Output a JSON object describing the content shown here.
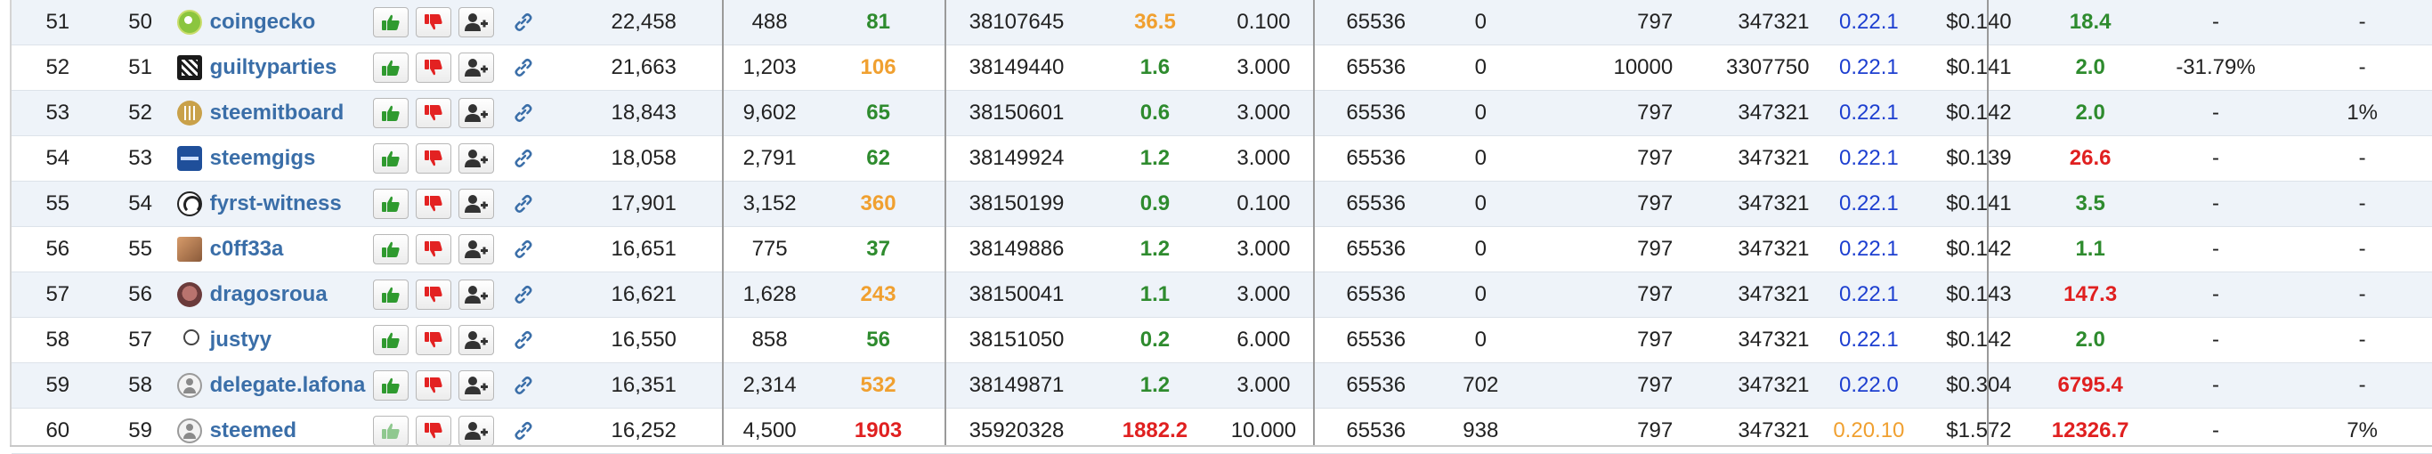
{
  "colors": {
    "green": "#2e8b2e",
    "orange": "#f0a030",
    "red": "#e02020",
    "blue": "#1d3fd0",
    "link": "#3a6ea8",
    "row_alt": "#eef3f9"
  },
  "actions": {
    "vote_icon": "thumbs-up-icon",
    "unvote_icon": "thumbs-down-icon",
    "proxy_icon": "add-user-icon",
    "link_icon": "chain-link-icon"
  },
  "rows": [
    {
      "rank": "51",
      "prev": "50",
      "name": "coingecko",
      "avatar": "coingecko",
      "votes": "22,458",
      "voters": "488",
      "missed": "81",
      "missed_color": "green",
      "last_block": "38107645",
      "hours": "36.5",
      "hours_color": "orange",
      "fee": "0.100",
      "size": "65536",
      "rate": "0",
      "sbd_interest": "797",
      "sbd_base": "347321",
      "version": "0.22.1",
      "version_color": "blue",
      "price": "$0.140",
      "feed": "18.4",
      "feed_color": "green",
      "change": "-",
      "extra": "-"
    },
    {
      "rank": "52",
      "prev": "51",
      "name": "guiltyparties",
      "avatar": "guilty",
      "votes": "21,663",
      "voters": "1,203",
      "missed": "106",
      "missed_color": "orange",
      "last_block": "38149440",
      "hours": "1.6",
      "hours_color": "green",
      "fee": "3.000",
      "size": "65536",
      "rate": "0",
      "sbd_interest": "10000",
      "sbd_base": "3307750",
      "version": "0.22.1",
      "version_color": "blue",
      "price": "$0.141",
      "feed": "2.0",
      "feed_color": "green",
      "change": "-31.79%",
      "extra": "-"
    },
    {
      "rank": "53",
      "prev": "52",
      "name": "steemitboard",
      "avatar": "board",
      "votes": "18,843",
      "voters": "9,602",
      "missed": "65",
      "missed_color": "green",
      "last_block": "38150601",
      "hours": "0.6",
      "hours_color": "green",
      "fee": "3.000",
      "size": "65536",
      "rate": "0",
      "sbd_interest": "797",
      "sbd_base": "347321",
      "version": "0.22.1",
      "version_color": "blue",
      "price": "$0.142",
      "feed": "2.0",
      "feed_color": "green",
      "change": "-",
      "extra": "1%"
    },
    {
      "rank": "54",
      "prev": "53",
      "name": "steemgigs",
      "avatar": "gigs",
      "votes": "18,058",
      "voters": "2,791",
      "missed": "62",
      "missed_color": "green",
      "last_block": "38149924",
      "hours": "1.2",
      "hours_color": "green",
      "fee": "3.000",
      "size": "65536",
      "rate": "0",
      "sbd_interest": "797",
      "sbd_base": "347321",
      "version": "0.22.1",
      "version_color": "blue",
      "price": "$0.139",
      "feed": "26.6",
      "feed_color": "red",
      "change": "-",
      "extra": "-"
    },
    {
      "rank": "55",
      "prev": "54",
      "name": "fyrst-witness",
      "avatar": "fyrst",
      "votes": "17,901",
      "voters": "3,152",
      "missed": "360",
      "missed_color": "orange",
      "last_block": "38150199",
      "hours": "0.9",
      "hours_color": "green",
      "fee": "0.100",
      "size": "65536",
      "rate": "0",
      "sbd_interest": "797",
      "sbd_base": "347321",
      "version": "0.22.1",
      "version_color": "blue",
      "price": "$0.141",
      "feed": "3.5",
      "feed_color": "green",
      "change": "-",
      "extra": "-"
    },
    {
      "rank": "56",
      "prev": "55",
      "name": "c0ff33a",
      "avatar": "coff",
      "votes": "16,651",
      "voters": "775",
      "missed": "37",
      "missed_color": "green",
      "last_block": "38149886",
      "hours": "1.2",
      "hours_color": "green",
      "fee": "3.000",
      "size": "65536",
      "rate": "0",
      "sbd_interest": "797",
      "sbd_base": "347321",
      "version": "0.22.1",
      "version_color": "blue",
      "price": "$0.142",
      "feed": "1.1",
      "feed_color": "green",
      "change": "-",
      "extra": "-"
    },
    {
      "rank": "57",
      "prev": "56",
      "name": "dragosroua",
      "avatar": "dragos",
      "votes": "16,621",
      "voters": "1,628",
      "missed": "243",
      "missed_color": "orange",
      "last_block": "38150041",
      "hours": "1.1",
      "hours_color": "green",
      "fee": "3.000",
      "size": "65536",
      "rate": "0",
      "sbd_interest": "797",
      "sbd_base": "347321",
      "version": "0.22.1",
      "version_color": "blue",
      "price": "$0.143",
      "feed": "147.3",
      "feed_color": "red",
      "change": "-",
      "extra": "-"
    },
    {
      "rank": "58",
      "prev": "57",
      "name": "justyy",
      "avatar": "justyy",
      "votes": "16,550",
      "voters": "858",
      "missed": "56",
      "missed_color": "green",
      "last_block": "38151050",
      "hours": "0.2",
      "hours_color": "green",
      "fee": "6.000",
      "size": "65536",
      "rate": "0",
      "sbd_interest": "797",
      "sbd_base": "347321",
      "version": "0.22.1",
      "version_color": "blue",
      "price": "$0.142",
      "feed": "2.0",
      "feed_color": "green",
      "change": "-",
      "extra": "-"
    },
    {
      "rank": "59",
      "prev": "58",
      "name": "delegate.lafona",
      "avatar": "default",
      "votes": "16,351",
      "voters": "2,314",
      "missed": "532",
      "missed_color": "orange",
      "last_block": "38149871",
      "hours": "1.2",
      "hours_color": "green",
      "fee": "3.000",
      "size": "65536",
      "rate": "702",
      "sbd_interest": "797",
      "sbd_base": "347321",
      "version": "0.22.0",
      "version_color": "blue",
      "price": "$0.304",
      "feed": "6795.4",
      "feed_color": "red",
      "change": "-",
      "extra": "-"
    },
    {
      "rank": "60",
      "prev": "59",
      "name": "steemed",
      "avatar": "default",
      "votes": "16,252",
      "voters": "4,500",
      "missed": "1903",
      "missed_color": "red",
      "last_block": "35920328",
      "hours": "1882.2",
      "hours_color": "red",
      "fee": "10.000",
      "size": "65536",
      "rate": "938",
      "sbd_interest": "797",
      "sbd_base": "347321",
      "version": "0.20.10",
      "version_color": "orange",
      "price": "$1.572",
      "feed": "12326.7",
      "feed_color": "red",
      "change": "-",
      "extra": "7%",
      "vote_faded": true
    }
  ]
}
